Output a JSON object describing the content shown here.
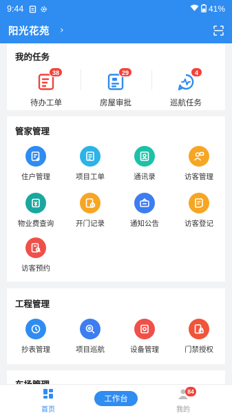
{
  "status_bar": {
    "time": "9:44",
    "battery": "41%"
  },
  "header": {
    "title": "阳光花苑",
    "chevron": "›"
  },
  "tasks": {
    "title": "我的任务",
    "items": [
      {
        "label": "待办工单",
        "badge": "38",
        "icon": "todo-list-icon"
      },
      {
        "label": "房屋审批",
        "badge": "29",
        "icon": "approval-icon"
      },
      {
        "label": "巡航任务",
        "badge": "4",
        "icon": "patrol-chat-icon"
      }
    ]
  },
  "butler": {
    "title": "管家管理",
    "items": [
      {
        "label": "住户管理",
        "color": "#2f8cf1",
        "icon": "resident-icon"
      },
      {
        "label": "项目工单",
        "color": "#2cb3e8",
        "icon": "work-order-icon"
      },
      {
        "label": "通讯录",
        "color": "#1dc1a8",
        "icon": "contacts-icon"
      },
      {
        "label": "访客管理",
        "color": "#f6a623",
        "icon": "visitor-icon"
      },
      {
        "label": "物业费查询",
        "color": "#1aa7a0",
        "icon": "fee-icon"
      },
      {
        "label": "开门记录",
        "color": "#f6a623",
        "icon": "door-log-icon"
      },
      {
        "label": "通知公告",
        "color": "#3d7df0",
        "icon": "notice-icon"
      },
      {
        "label": "访客登记",
        "color": "#f6a623",
        "icon": "visitor-register-icon"
      },
      {
        "label": "访客预约",
        "color": "#f0504a",
        "icon": "visitor-booking-icon"
      }
    ]
  },
  "engineering": {
    "title": "工程管理",
    "items": [
      {
        "label": "抄表管理",
        "color": "#2f8cf1",
        "icon": "meter-icon"
      },
      {
        "label": "项目巡航",
        "color": "#3d7df0",
        "icon": "project-patrol-icon"
      },
      {
        "label": "设备管理",
        "color": "#f0504a",
        "icon": "device-icon"
      },
      {
        "label": "门禁授权",
        "color": "#f0543a",
        "icon": "access-icon"
      }
    ]
  },
  "parking": {
    "title": "车场管理"
  },
  "tabbar": {
    "home": "首页",
    "workbench": "工作台",
    "mine": "我的",
    "mine_badge": "84",
    "active_color": "#2f8cf1",
    "inactive_color": "#9a9a9a"
  }
}
